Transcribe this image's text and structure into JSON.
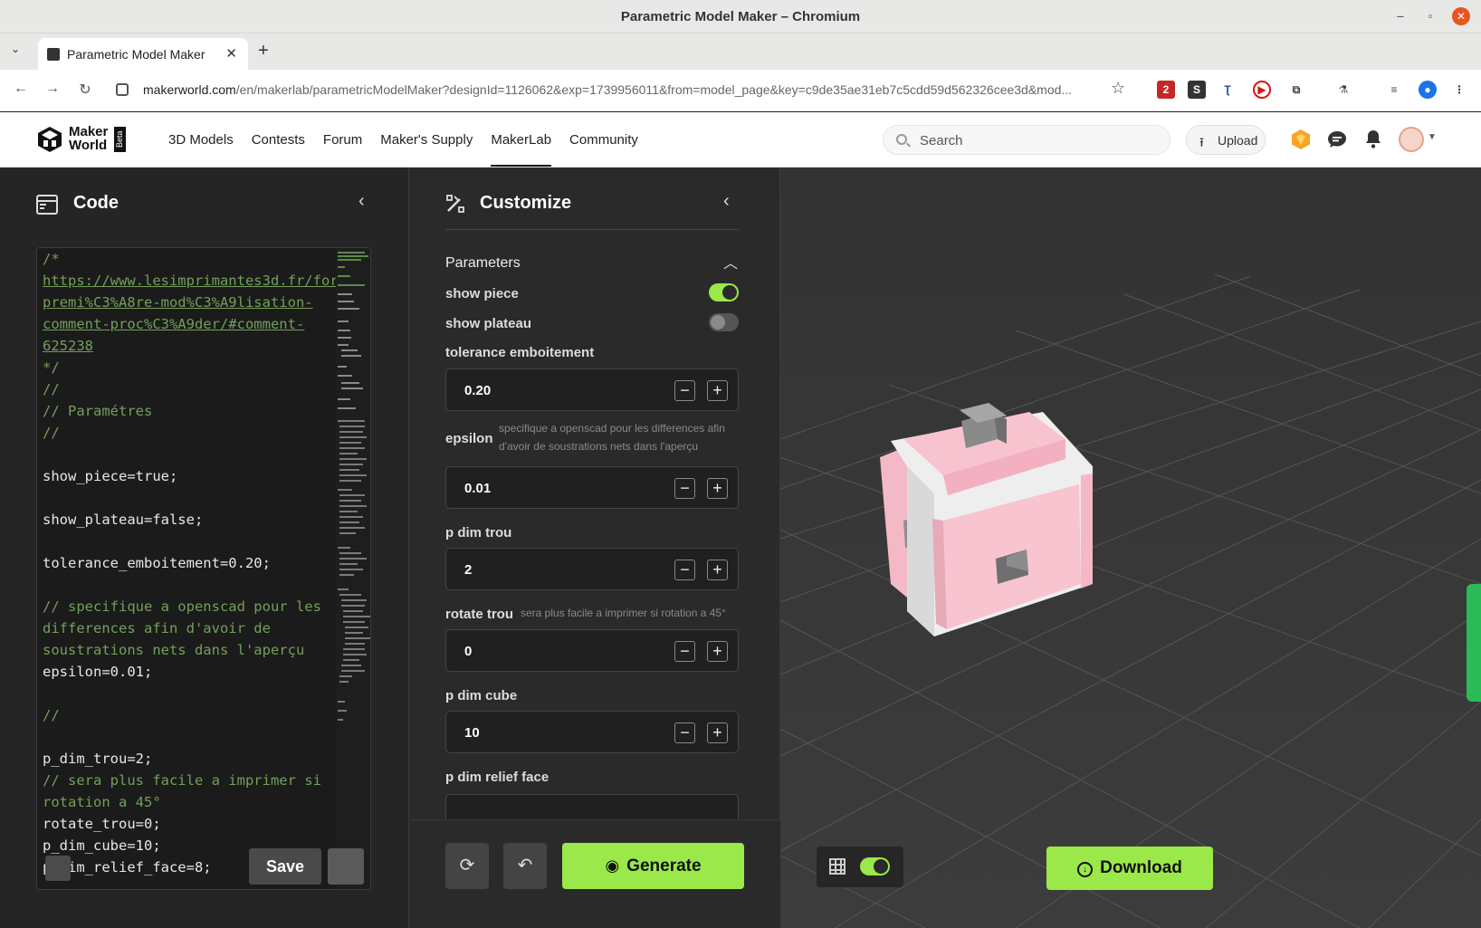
{
  "window": {
    "title": "Parametric Model Maker – Chromium"
  },
  "browser": {
    "tab_title": "Parametric Model Maker",
    "url_domain": "makerworld.com",
    "url_path": "/en/makerlab/parametricModelMaker?designId=1126062&exp=1739956011&from=model_page&key=c9de35ae31eb7c5cdd59d562326cee3d&mod...",
    "ext_badge": "2"
  },
  "site": {
    "logo_line1": "Maker",
    "logo_line2": "World",
    "beta": "Beta",
    "nav": [
      "3D Models",
      "Contests",
      "Forum",
      "Maker's Supply",
      "MakerLab",
      "Community"
    ],
    "search_placeholder": "Search",
    "upload_label": "Upload"
  },
  "code_panel": {
    "title": "Code",
    "save_label": "Save"
  },
  "customize": {
    "title": "Customize",
    "section": "Parameters",
    "show_piece": {
      "label": "show piece",
      "on": true
    },
    "show_plateau": {
      "label": "show plateau",
      "on": false
    },
    "tolerance": {
      "label": "tolerance emboitement",
      "value": "0.20"
    },
    "epsilon": {
      "label": "epsilon",
      "note": "specifique a openscad pour les differences afin d'avoir de soustrations nets dans l'aperçu",
      "value": "0.01"
    },
    "p_dim_trou": {
      "label": "p dim trou",
      "value": "2"
    },
    "rotate_trou": {
      "label": "rotate trou",
      "note": "sera plus facile a imprimer si rotation a 45°",
      "value": "0"
    },
    "p_dim_cube": {
      "label": "p dim cube",
      "value": "10"
    },
    "p_dim_relief": {
      "label": "p dim relief face"
    },
    "generate_label": "Generate"
  },
  "viewport": {
    "grid_on": true,
    "download_label": "Download",
    "colors": {
      "model": "#f7c3cf",
      "frame": "#efefef",
      "background": "#3a3a3a",
      "accent": "#9be84b"
    }
  }
}
